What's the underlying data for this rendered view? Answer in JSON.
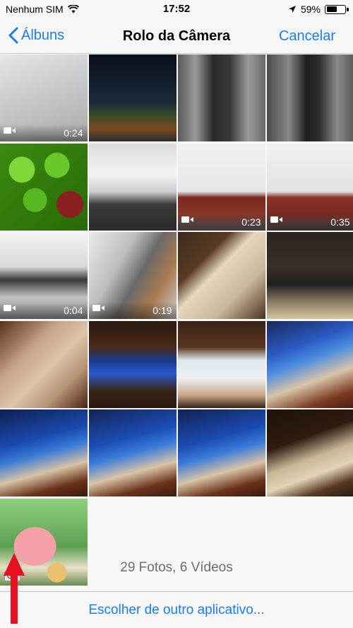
{
  "status_bar": {
    "carrier": "Nenhum SIM",
    "time": "17:52",
    "battery": "59%",
    "battery_level": 0.59
  },
  "nav": {
    "back_label": "Álbuns",
    "title": "Rolo da Câmera",
    "cancel_label": "Cancelar"
  },
  "photos": [
    {
      "kind": "video",
      "duration": "0:24",
      "bg": "linear-gradient(160deg,#e6e6e6 0%,#c9c9c9 45%,#a9a9a9 100%)"
    },
    {
      "kind": "photo",
      "bg": "linear-gradient(180deg,#0a0f1c 0%,#1d2a3a 55%,#3a4a2a 70%,#7a4a20 85%,#2a2a30 100%)"
    },
    {
      "kind": "photo",
      "bg": "linear-gradient(90deg,#5a5a5a 0%,#9a9a9a 20%,#2a2a2a 40%,#3a3a3a 60%,#9a9a9a 80%,#6a6a6a 100%)"
    },
    {
      "kind": "photo",
      "bg": "linear-gradient(90deg,#4a4a4a 0%,#8a8a8a 25%,#1e1e1e 45%,#2e2e2e 60%,#8a8a8a 80%,#5a5a5a 100%)"
    },
    {
      "kind": "photo",
      "bg": "radial-gradient(circle at 25% 30%,#7fd83a 0 14%,transparent 15%),radial-gradient(circle at 65% 25%,#6cc82a 0 14%,transparent 15%),radial-gradient(circle at 40% 65%,#58b820 0 15%,transparent 16%),radial-gradient(circle at 80% 70%,#8a2020 0 14%,transparent 15%),linear-gradient(135deg,#3a8a10,#2a6a08)"
    },
    {
      "kind": "photo",
      "bg": "linear-gradient(180deg,#dcdcdc 0%,#f2f2f2 35%,#cfcfcf 55%,#3a3a3a 70%,#2a2a2a 100%)"
    },
    {
      "kind": "video",
      "duration": "0:23",
      "bg": "linear-gradient(180deg,#f1f1f3 0%,#e3e6ea 55%,#7a2a20 62%,#8a3428 80%,#6a6a6a 100%)"
    },
    {
      "kind": "video",
      "duration": "0:35",
      "bg": "linear-gradient(180deg,#f1f1f3 0%,#e0e2e6 55%,#8a3428 62%,#7a2a20 80%,#5a5a5a 100%)"
    },
    {
      "kind": "video",
      "duration": "0:04",
      "bg": "linear-gradient(180deg,#f4f4f4 0%,#d8d8d8 40%,#3a3a3a 55%,#c0c0c0 75%,#9a9a9a 100%)"
    },
    {
      "kind": "video",
      "duration": "0:19",
      "bg": "linear-gradient(120deg,#eaeaea 0%,#bdbdbd 35%,#6a6a6a 55%,#a97a50 75%,#cfcfcf 100%)"
    },
    {
      "kind": "photo",
      "bg": "linear-gradient(135deg,#3a2a1e 0%,#5a3a24 30%,#e6d6bd 45%,#c9b79a 70%,#4a3222 100%)"
    },
    {
      "kind": "photo",
      "bg": "linear-gradient(180deg,#2a2420 0%,#3a3028 40%,#1e1e1e 60%,#8a7a60 80%,#d6c6a0 100%)"
    },
    {
      "kind": "photo",
      "bg": "linear-gradient(135deg,#5a3018 0%,#c9a58a 35%,#dcc4a8 55%,#b59274 75%,#4a2414 100%)"
    },
    {
      "kind": "photo",
      "bg": "linear-gradient(180deg,#2a1a10 0%,#4a2a18 30%,#1a3a8a 45%,#2a5ad0 60%,#3a2418 80%,#2a1a10 100%)"
    },
    {
      "kind": "photo",
      "bg": "linear-gradient(180deg,#3a2414 0%,#5a3420 30%,#dfe6f0 45%,#eef1f5 65%,#c9a88a 85%,#3a2414 100%)"
    },
    {
      "kind": "photo",
      "bg": "linear-gradient(160deg,#1a2a5a 0%,#2a5ac0 30%,#4a8ae0 45%,#d8c4a8 65%,#7a3a20 85%,#4a2010 100%)"
    },
    {
      "kind": "photo",
      "bg": "linear-gradient(165deg,#102050 0%,#1a4ab0 35%,#3a7ad8 50%,#d6c2a4 68%,#6a3018 85%,#3a1a0c 100%)"
    },
    {
      "kind": "photo",
      "bg": "linear-gradient(165deg,#122456 0%,#1c4eb6 35%,#3c7cda 50%,#d8c4a6 68%,#6c321a 85%,#3c1c0e 100%)"
    },
    {
      "kind": "photo",
      "bg": "linear-gradient(165deg,#112252 0%,#1b4cb3 35%,#3b7bd9 50%,#d7c3a5 68%,#6b3119 85%,#3b1b0d 100%)"
    },
    {
      "kind": "photo",
      "bg": "linear-gradient(160deg,#1e120a 0%,#2e1c10 35%,#c9b698 55%,#e2d2b6 70%,#5a3a22 85%,#2a1a0e 100%)"
    },
    {
      "kind": "gif",
      "badge": "GIF",
      "bg": "radial-gradient(ellipse at 40% 55%,#f4a0a8 0 28%,transparent 29%),radial-gradient(circle at 65% 85%,#e8c070 0 10%,transparent 11%),linear-gradient(180deg,#8fd080 0%,#5aa050 55%,#e8e0c8 80%,#6a8a50 100%)"
    }
  ],
  "footer": {
    "count_text": "29 Fotos, 6 Vídeos",
    "other_app_label": "Escolher de outro aplicativo..."
  }
}
